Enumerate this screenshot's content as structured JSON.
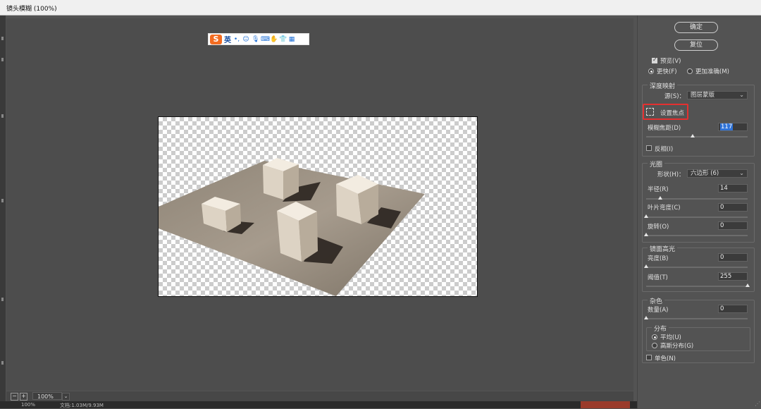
{
  "window": {
    "title": "镜头模糊 (100%)"
  },
  "ime": {
    "logo": "S",
    "lang": "英"
  },
  "buttons": {
    "ok": "确定",
    "reset": "复位"
  },
  "preview": {
    "label": "预览(V)",
    "checked": true,
    "fast": "更快(F)",
    "accurate": "更加准确(M)",
    "selected": "fast"
  },
  "depth_map": {
    "title": "深度映射",
    "source_label": "源(S)：",
    "source_value": "图层蒙版",
    "focus_button": "设置焦点",
    "blur_focal_label": "模糊焦距(D)",
    "blur_focal_value": "117",
    "blur_focal_fraction": 0.46,
    "invert_label": "反相(I)",
    "invert_checked": false
  },
  "iris": {
    "title": "光圈",
    "shape_label": "形状(H)：",
    "shape_value": "六边形 (6)",
    "radius_label": "半径(R)",
    "radius_value": "14",
    "radius_fraction": 0.14,
    "curvature_label": "叶片弯度(C)",
    "curvature_value": "0",
    "curvature_fraction": 0,
    "rotation_label": "旋转(O)",
    "rotation_value": "0",
    "rotation_fraction": 0
  },
  "specular": {
    "title": "镜面高光",
    "brightness_label": "亮度(B)",
    "brightness_value": "0",
    "brightness_fraction": 0,
    "threshold_label": "阈值(T)",
    "threshold_value": "255",
    "threshold_fraction": 1
  },
  "noise": {
    "title": "杂色",
    "amount_label": "数量(A)",
    "amount_value": "0",
    "amount_fraction": 0,
    "distribution_title": "分布",
    "uniform": "平均(U)",
    "gaussian": "高斯分布(G)",
    "selected": "uniform",
    "mono_label": "单色(N)",
    "mono_checked": false
  },
  "status": {
    "zoom": "100%",
    "minus": "−",
    "plus": "+"
  },
  "bottom": {
    "zoom": "100%",
    "doc": "文档:1.03M/9.93M"
  }
}
